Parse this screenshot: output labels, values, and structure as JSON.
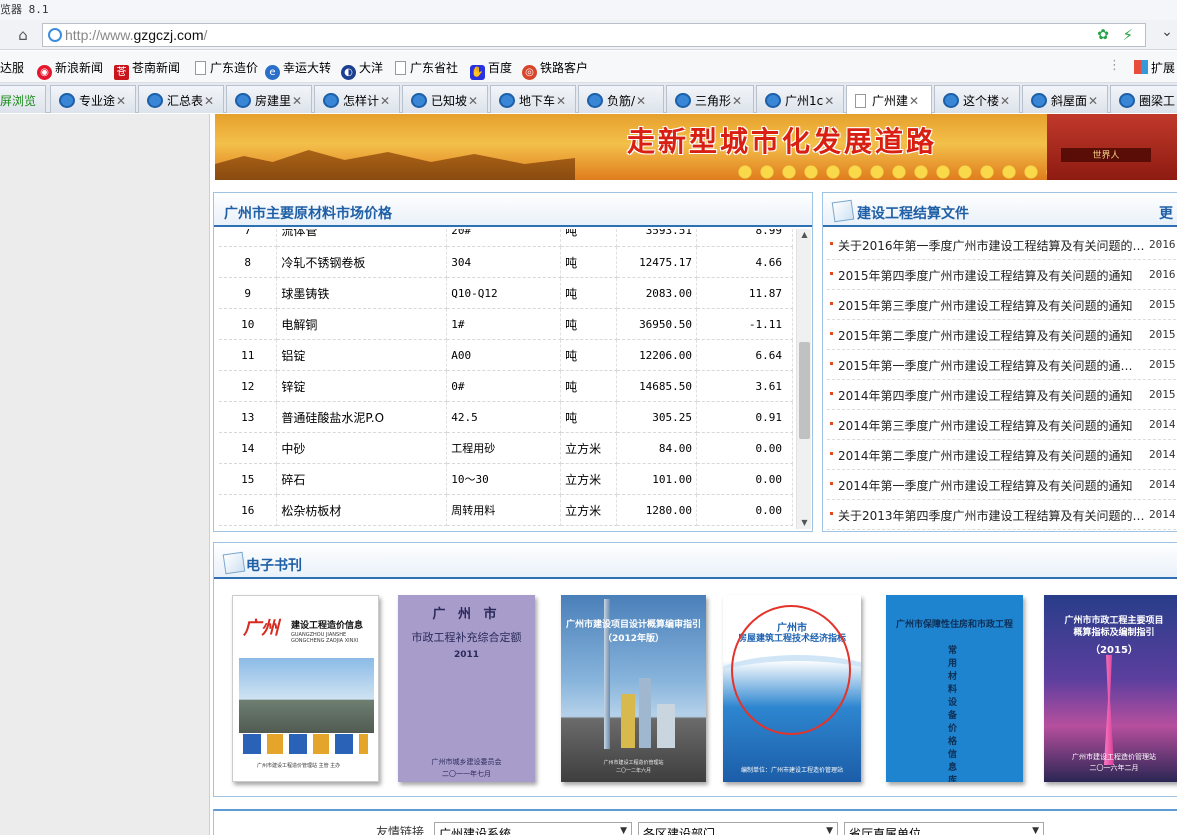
{
  "window": {
    "title": "览器 8.1"
  },
  "address": {
    "url_prefix": "http://www.",
    "url_domain": "gzgczj.com",
    "url_suffix": "/"
  },
  "bookmarks": [
    {
      "label": "达服",
      "icon": "wrench-icon"
    },
    {
      "label": "新浪新闻",
      "icon": "weibo-icon",
      "color": "#e6162d"
    },
    {
      "label": "苍南新闻",
      "icon": "news-icon",
      "color": "#c9161e"
    },
    {
      "label": "广东造价",
      "icon": "page-icon"
    },
    {
      "label": "幸运大转",
      "icon": "ie-icon",
      "color": "#2a6fc9"
    },
    {
      "label": "大洋",
      "icon": "dayang-icon",
      "color": "#1b3f91"
    },
    {
      "label": "广东省社",
      "icon": "page-icon"
    },
    {
      "label": "百度",
      "icon": "baidu-icon",
      "color": "#2932e1"
    },
    {
      "label": "铁路客户",
      "icon": "rail-icon",
      "color": "#d9452b"
    }
  ],
  "extensions": {
    "dots": "⋮",
    "label": "扩展"
  },
  "tabs": [
    {
      "label": "屏浏览"
    },
    {
      "label": "专业途"
    },
    {
      "label": "汇总表"
    },
    {
      "label": "房建里"
    },
    {
      "label": "怎样计"
    },
    {
      "label": "已知坡"
    },
    {
      "label": "地下车"
    },
    {
      "label": "负筋/"
    },
    {
      "label": "三角形"
    },
    {
      "label": "广州1c"
    },
    {
      "label": "广州建"
    },
    {
      "label": "这个楼"
    },
    {
      "label": "斜屋面"
    },
    {
      "label": "圈梁工"
    }
  ],
  "banner": {
    "title": "走新型城市化发展道路",
    "gate_text": "世界人"
  },
  "prices": {
    "title": "广州市主要原材料市场价格",
    "rows": [
      [
        "7",
        "流体管",
        "20#",
        "吨",
        "3593.51",
        "8.99"
      ],
      [
        "8",
        "冷轧不锈钢卷板",
        "304",
        "吨",
        "12475.17",
        "4.66"
      ],
      [
        "9",
        "球墨铸铁",
        "Q10-Q12",
        "吨",
        "2083.00",
        "11.87"
      ],
      [
        "10",
        "电解铜",
        "1#",
        "吨",
        "36950.50",
        "-1.11"
      ],
      [
        "11",
        "铝锭",
        "A00",
        "吨",
        "12206.00",
        "6.64"
      ],
      [
        "12",
        "锌锭",
        "0#",
        "吨",
        "14685.50",
        "3.61"
      ],
      [
        "13",
        "普通硅酸盐水泥P.O",
        "42.5",
        "吨",
        "305.25",
        "0.91"
      ],
      [
        "14",
        "中砂",
        "工程用砂",
        "立方米",
        "84.00",
        "0.00"
      ],
      [
        "15",
        "碎石",
        "10～30",
        "立方米",
        "101.00",
        "0.00"
      ],
      [
        "16",
        "松杂枋板材",
        "周转用料",
        "立方米",
        "1280.00",
        "0.00"
      ]
    ]
  },
  "settlement": {
    "title": "建设工程结算文件",
    "more": "更",
    "items": [
      {
        "text": "关于2016年第一季度广州市建设工程结算及有关问题的…",
        "date": "2016.0"
      },
      {
        "text": "2015年第四季度广州市建设工程结算及有关问题的通知",
        "date": "2016.0"
      },
      {
        "text": "2015年第三季度广州市建设工程结算及有关问题的通知",
        "date": "2015.0"
      },
      {
        "text": "2015年第二季度广州市建设工程结算及有关问题的通知",
        "date": "2015.0"
      },
      {
        "text": "2015年第一季度广州市建设工程结算及有关问题的通…",
        "date": "2015.0"
      },
      {
        "text": "2014年第四季度广州市建设工程结算及有关问题的通知",
        "date": "2015.0"
      },
      {
        "text": "2014年第三季度广州市建设工程结算及有关问题的通知",
        "date": "2014.0"
      },
      {
        "text": "2014年第二季度广州市建设工程结算及有关问题的通知",
        "date": "2014.0"
      },
      {
        "text": "2014年第一季度广州市建设工程结算及有关问题的通知",
        "date": "2014.0"
      },
      {
        "text": "关于2013年第四季度广州市建设工程结算及有关问题的…",
        "date": "2014.0"
      }
    ]
  },
  "ebooks": {
    "title": "电子书刊",
    "book1": {
      "brand": "广州",
      "name": "建设工程造价信息",
      "pinyin": "GUANGZHOU JIANSHE GONGCHENG ZAOJIA XINXI",
      "org": "广州市建设工程造价管理站 主管 主办"
    },
    "book2": {
      "a": "广 州 市",
      "b": "市政工程补充综合定额",
      "c": "2011",
      "d": "广州市城乡建设委员会",
      "e": "二〇一一年七月"
    },
    "book3": {
      "a": "广州市建设项目设计概算编审指引",
      "b": "（2012年版）",
      "foot": "广州市建设工程造价管理站",
      "foot2": "二〇一二年六月"
    },
    "book4": {
      "a": "广州市",
      "b": "房屋建筑工程技术经济指标",
      "foot": "编制单位：广州市建设工程造价管理站"
    },
    "book5": {
      "a": "广州市保障性住房和市政工程",
      "v": "常用材料设备价格信息库"
    },
    "book6": {
      "a": "广州市市政工程主要项目",
      "b": "概算指标及编制指引",
      "c": "（2015）",
      "foot": "广州市建设工程造价管理站",
      "foot2": "二〇一六年二月"
    }
  },
  "links": {
    "label": "友情链接",
    "selects": [
      "广州建设系统",
      "各区建设部门",
      "省厅直属单位"
    ]
  }
}
